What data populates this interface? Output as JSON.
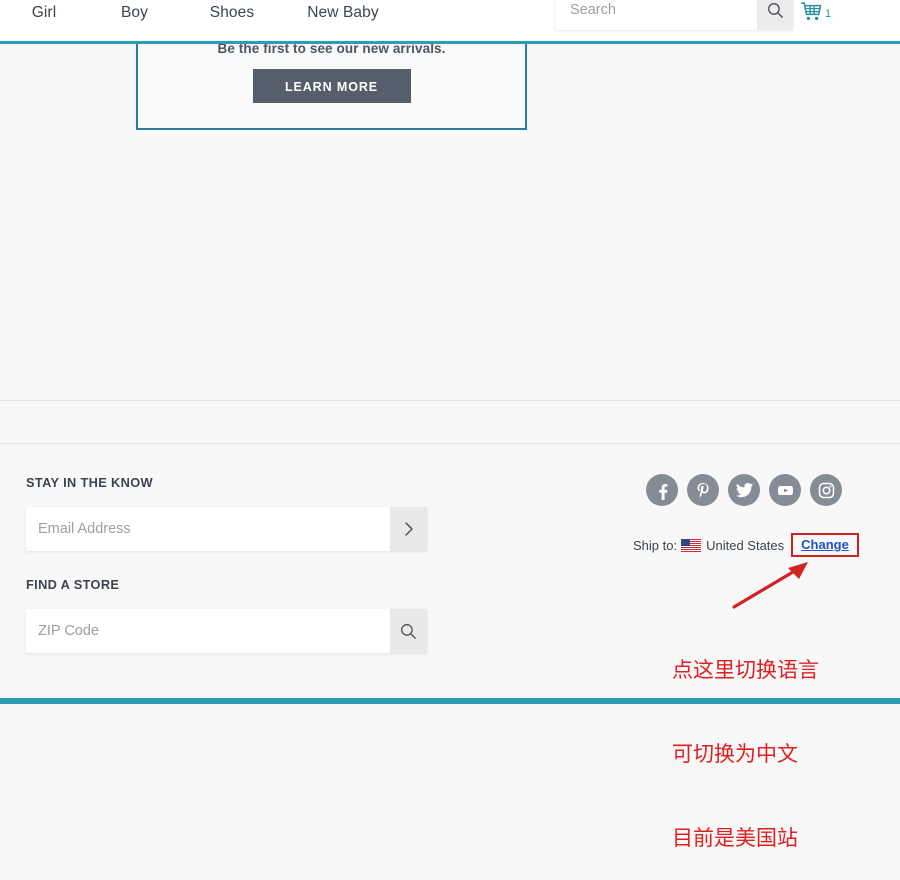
{
  "header": {
    "nav_items": [
      {
        "label": "Girl",
        "name": "nav-link-girl"
      },
      {
        "label": "Boy",
        "name": "nav-link-boy"
      },
      {
        "label": "Shoes",
        "name": "nav-link-shoes"
      },
      {
        "label": "New Baby",
        "name": "nav-link-new-baby"
      }
    ],
    "search": {
      "placeholder": "Search",
      "value": "",
      "icon": "search-icon"
    },
    "cart": {
      "icon": "shopping-cart-icon",
      "count": "1"
    },
    "rule_color": "#2f9cb5"
  },
  "promo": {
    "text": "Be the first to see our new arrivals.",
    "cta_label": "LEARN MORE",
    "border_color": "#2a7fa0",
    "cta_color": "#555f6b"
  },
  "footer": {
    "stay_heading": "STAY IN THE KNOW",
    "email": {
      "placeholder": "Email Address",
      "value": "",
      "submit_icon": "chevron-right-icon"
    },
    "store_heading": "FIND A STORE",
    "zip": {
      "placeholder": "ZIP Code",
      "value": "",
      "submit_icon": "search-icon"
    },
    "social": [
      {
        "name": "facebook-icon",
        "label": "Facebook"
      },
      {
        "name": "pinterest-icon",
        "label": "Pinterest"
      },
      {
        "name": "twitter-icon",
        "label": "Twitter"
      },
      {
        "name": "youtube-icon",
        "label": "YouTube"
      },
      {
        "name": "instagram-icon",
        "label": "Instagram"
      }
    ],
    "social_color": "#868c96",
    "ship": {
      "label": "Ship to:",
      "country": "United States",
      "flag_icon": "us-flag-icon",
      "change_label": "Change",
      "change_color": "#1f54c8",
      "highlight_color": "#cc2222"
    }
  },
  "annotation": {
    "line1": "点这里切换语言",
    "line2": "可切换为中文",
    "line3": "目前是美国站",
    "color": "#e02020",
    "arrow_icon": "red-arrow-icon"
  }
}
